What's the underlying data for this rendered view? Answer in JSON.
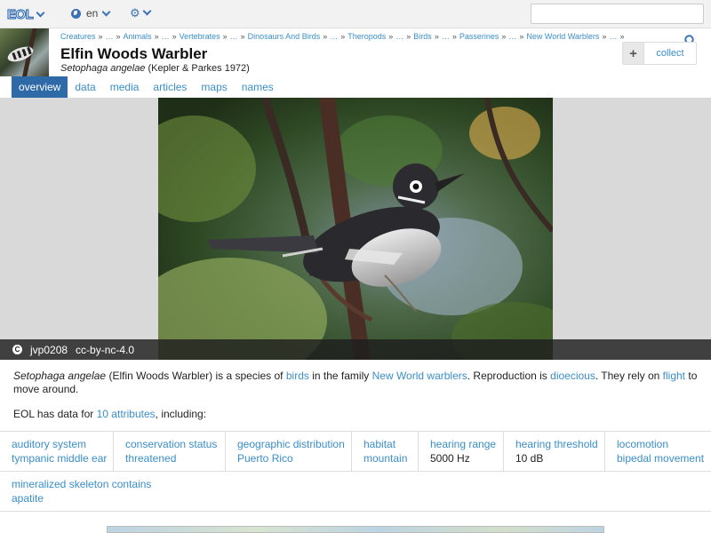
{
  "topbar": {
    "logo_text": "EOL",
    "language": "en",
    "search_placeholder": ""
  },
  "header": {
    "breadcrumbs": [
      "Creatures",
      "…",
      "Animals",
      "…",
      "Vertebrates",
      "…",
      "Dinosaurs And Birds",
      "…",
      "Theropods",
      "…",
      "Birds",
      "…",
      "Passerines",
      "…",
      "New World Warblers",
      "…"
    ],
    "title": "Elfin Woods Warbler",
    "scientific_name": "Setophaga angelae",
    "authority": "(Kepler & Parkes 1972)",
    "collect_label": "collect",
    "collect_plus": "+"
  },
  "tabs": [
    "overview",
    "data",
    "media",
    "articles",
    "maps",
    "names"
  ],
  "hero": {
    "cc_symbol": "C",
    "author": "jvp0208",
    "license": "cc-by-nc-4.0"
  },
  "description": {
    "sci": "Setophaga angelae",
    "common": "(Elfin Woods Warbler) is a species of",
    "link_birds": "birds",
    "text_family": "in the family",
    "link_family": "New World warblers",
    "text_repro": ". Reproduction is",
    "link_repro": "dioecious",
    "text_rely": ". They rely on",
    "link_flight": "flight",
    "text_end": "to move around."
  },
  "data_note": {
    "prefix": "EOL has data for",
    "link": "10 attributes",
    "suffix": ", including:"
  },
  "attributes": [
    [
      {
        "key": "auditory system",
        "value": "tympanic middle ear",
        "linked": true
      },
      {
        "key": "conservation status",
        "value": "threatened",
        "linked": true
      },
      {
        "key": "geographic distribution",
        "value": "Puerto Rico",
        "linked": true
      },
      {
        "key": "habitat",
        "value": "mountain",
        "linked": true
      },
      {
        "key": "hearing range",
        "value": "5000 Hz",
        "linked": false
      },
      {
        "key": "hearing threshold",
        "value": "10 dB",
        "linked": false
      },
      {
        "key": "locomotion",
        "value": "bipedal movement",
        "linked": true
      }
    ],
    [
      {
        "key": "mineralized skeleton contains",
        "value": "apatite",
        "linked": true
      }
    ]
  ],
  "colors": {
    "link": "#3a8ec9",
    "active_tab": "#2f6aa8",
    "logo": "#3a72b5"
  },
  "icons": [
    "eol-logo",
    "chevron-down-icon",
    "globe-icon",
    "gear-icon",
    "search-icon",
    "plus-icon",
    "cc-icon"
  ]
}
